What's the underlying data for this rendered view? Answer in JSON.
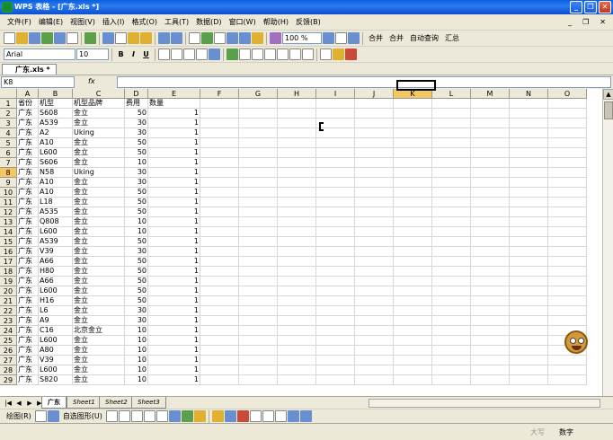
{
  "window": {
    "title": "WPS 表格 - [广东.xls *]"
  },
  "menu": {
    "items": [
      "文件(F)",
      "编辑(E)",
      "视图(V)",
      "插入(I)",
      "格式(O)",
      "工具(T)",
      "数据(D)",
      "窗口(W)",
      "帮助(H)",
      "反馈(B)"
    ]
  },
  "toolbar": {
    "zoom": "100 %",
    "buttons": [
      "合并",
      "合并",
      "自动查询",
      "汇总"
    ]
  },
  "format": {
    "font": "Arial",
    "size": "10",
    "bold": "B",
    "italic": "I",
    "underline": "U"
  },
  "document": {
    "tab": "广东.xls *"
  },
  "formula": {
    "namebox": "K8",
    "fx": "fx",
    "value": ""
  },
  "sheet": {
    "columns": [
      "A",
      "B",
      "C",
      "D",
      "E",
      "F",
      "G",
      "H",
      "I",
      "J",
      "K",
      "L",
      "M",
      "N",
      "O"
    ],
    "selected_col": "K",
    "selected_row": "8",
    "header": [
      "省份",
      "机型",
      "机型品牌",
      "费用",
      "数量"
    ],
    "rows": [
      [
        "广东",
        "S608",
        "金立",
        "50",
        "1"
      ],
      [
        "广东",
        "A539",
        "金立",
        "30",
        "1"
      ],
      [
        "广东",
        "A2",
        "Uking",
        "30",
        "1"
      ],
      [
        "广东",
        "A10",
        "金立",
        "50",
        "1"
      ],
      [
        "广东",
        "L600",
        "金立",
        "50",
        "1"
      ],
      [
        "广东",
        "S606",
        "金立",
        "10",
        "1"
      ],
      [
        "广东",
        "N58",
        "Uking",
        "30",
        "1"
      ],
      [
        "广东",
        "A10",
        "金立",
        "30",
        "1"
      ],
      [
        "广东",
        "A10",
        "金立",
        "50",
        "1"
      ],
      [
        "广东",
        "L18",
        "金立",
        "50",
        "1"
      ],
      [
        "广东",
        "A535",
        "金立",
        "50",
        "1"
      ],
      [
        "广东",
        "Q808",
        "金立",
        "10",
        "1"
      ],
      [
        "广东",
        "L600",
        "金立",
        "10",
        "1"
      ],
      [
        "广东",
        "A539",
        "金立",
        "50",
        "1"
      ],
      [
        "广东",
        "V39",
        "金立",
        "30",
        "1"
      ],
      [
        "广东",
        "A66",
        "金立",
        "50",
        "1"
      ],
      [
        "广东",
        "H80",
        "金立",
        "50",
        "1"
      ],
      [
        "广东",
        "A66",
        "金立",
        "50",
        "1"
      ],
      [
        "广东",
        "L600",
        "金立",
        "50",
        "1"
      ],
      [
        "广东",
        "H16",
        "金立",
        "50",
        "1"
      ],
      [
        "广东",
        "L6",
        "金立",
        "30",
        "1"
      ],
      [
        "广东",
        "A9",
        "金立",
        "30",
        "1"
      ],
      [
        "广东",
        "C16",
        "北京金立",
        "10",
        "1"
      ],
      [
        "广东",
        "L600",
        "金立",
        "10",
        "1"
      ],
      [
        "广东",
        "A80",
        "金立",
        "10",
        "1"
      ],
      [
        "广东",
        "V39",
        "金立",
        "10",
        "1"
      ],
      [
        "广东",
        "L600",
        "金立",
        "10",
        "1"
      ],
      [
        "广东",
        "S820",
        "金立",
        "10",
        "1"
      ]
    ]
  },
  "sheettabs": [
    "广东",
    "Sheet1",
    "Sheet2",
    "Sheet3"
  ],
  "drawbar": {
    "shapes": "绘图(R)",
    "autoshapes": "自选图形(U)"
  },
  "status": {
    "caps": "大写",
    "num": "数字"
  }
}
